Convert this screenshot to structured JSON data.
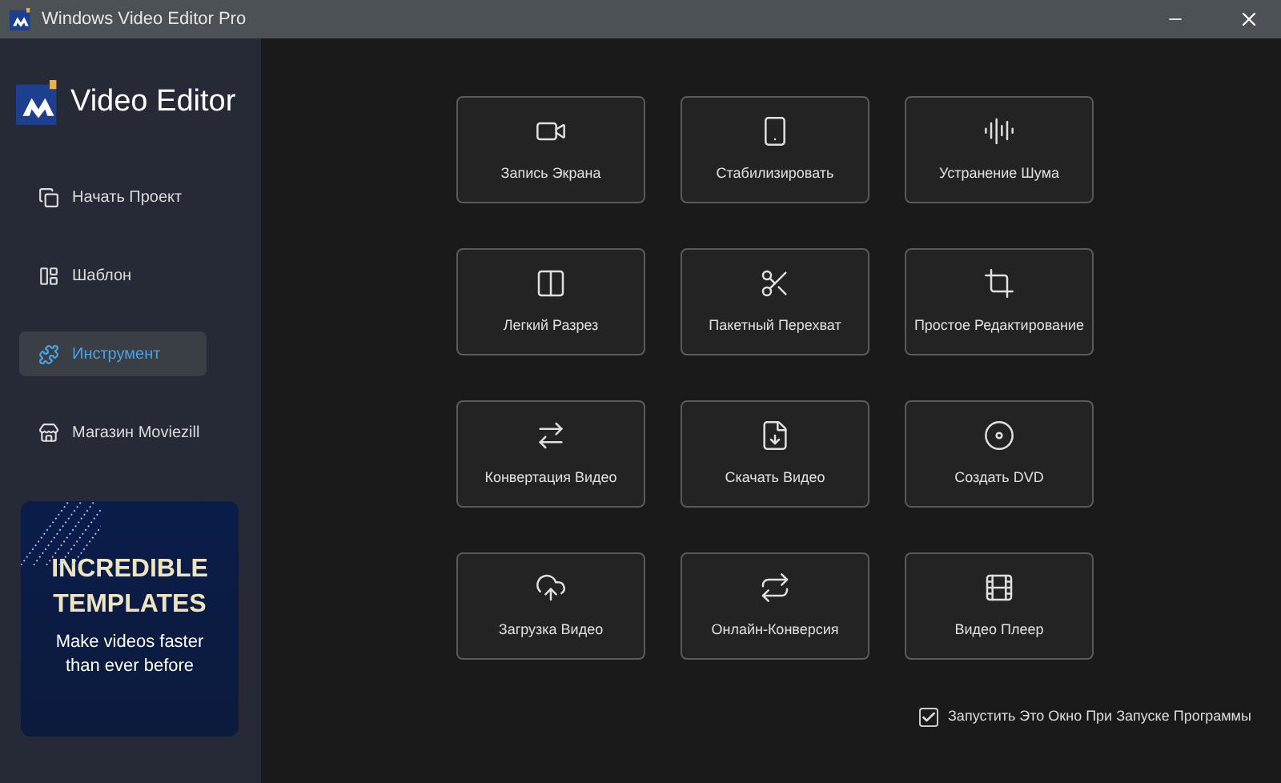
{
  "window": {
    "title": "Windows Video Editor Pro"
  },
  "sidebar": {
    "brand": "Video Editor",
    "items": [
      {
        "label": "Начать Проект",
        "selected": false
      },
      {
        "label": "Шаблон",
        "selected": false
      },
      {
        "label": "Инструмент",
        "selected": true
      },
      {
        "label": "Магазин Moviezill",
        "selected": false
      }
    ],
    "banner": {
      "title_line1": "INCREDIBLE",
      "title_line2": "TEMPLATES",
      "subtitle": "Make videos faster than ever before"
    }
  },
  "tools": [
    {
      "label": "Запись Экрана"
    },
    {
      "label": "Стабилизировать"
    },
    {
      "label": "Устранение Шума"
    },
    {
      "label": "Легкий Разрез"
    },
    {
      "label": "Пакетный Перехват"
    },
    {
      "label": "Простое Редактирование"
    },
    {
      "label": "Конвертация Видео"
    },
    {
      "label": "Скачать Видео"
    },
    {
      "label": "Создать DVD"
    },
    {
      "label": "Загрузка Видео"
    },
    {
      "label": "Онлайн-Конверсия"
    },
    {
      "label": "Видео Плеер"
    }
  ],
  "startup_checkbox": {
    "label": "Запустить Это Окно При Запуске Программы",
    "checked": true
  }
}
